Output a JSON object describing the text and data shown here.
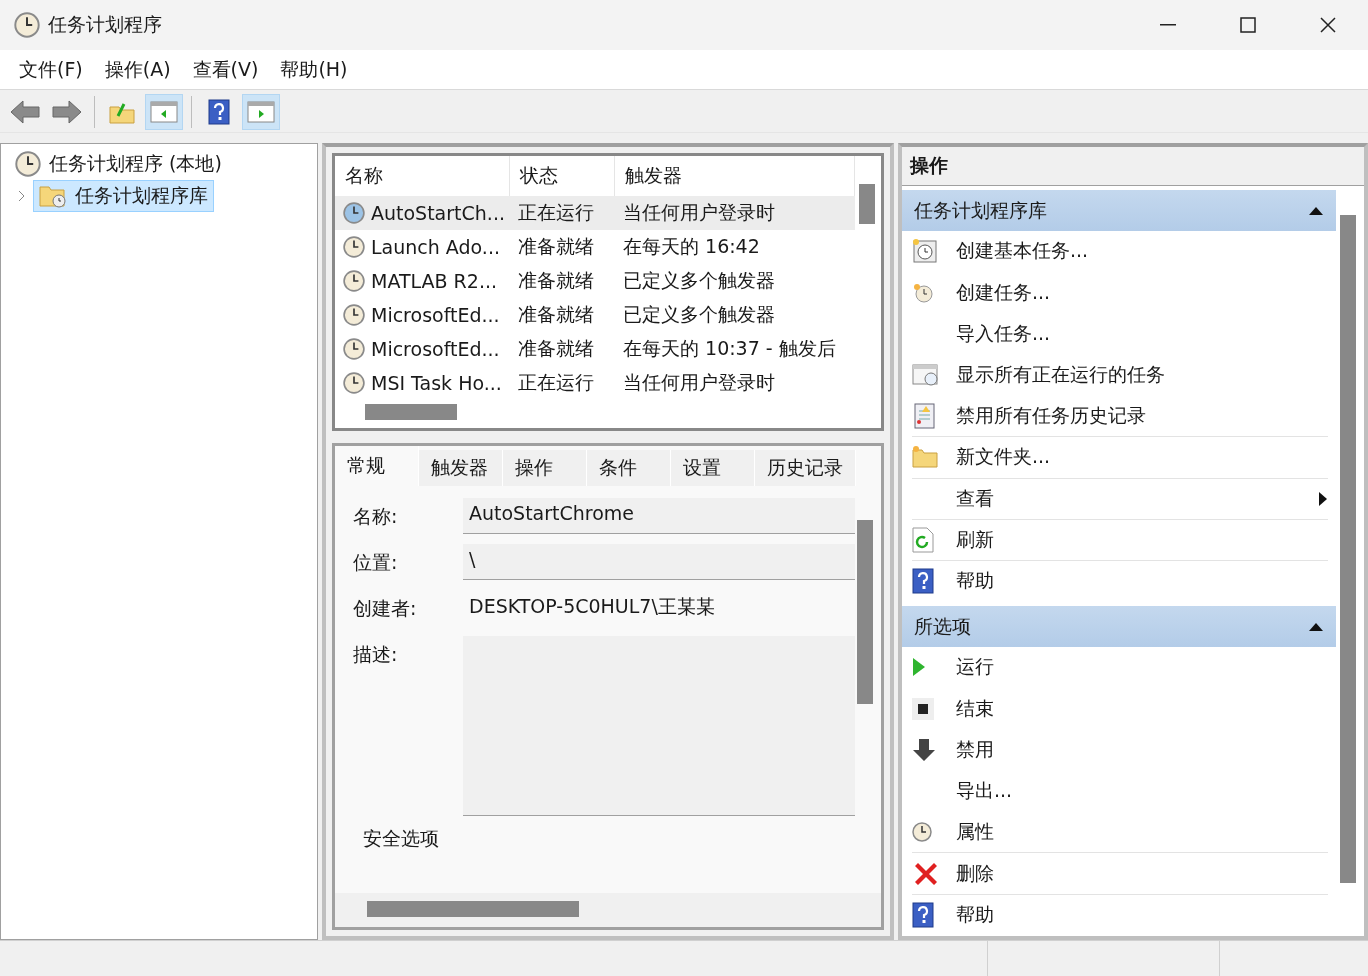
{
  "window": {
    "title": "任务计划程序"
  },
  "menu": [
    "文件(F)",
    "操作(A)",
    "查看(V)",
    "帮助(H)"
  ],
  "toolbar": [
    {
      "kind": "back",
      "selected": false
    },
    {
      "kind": "forward",
      "selected": false
    },
    {
      "kind": "up",
      "selected": false
    },
    {
      "kind": "tree",
      "selected": true
    },
    {
      "kind": "help",
      "selected": false
    },
    {
      "kind": "actions",
      "selected": true
    }
  ],
  "tree": {
    "label": "任务计划程序 (本地)",
    "children": [
      {
        "label": "任务计划程序库",
        "selected": true,
        "expanded": false
      }
    ]
  },
  "task_list": {
    "columns": [
      "名称",
      "状态",
      "触发器"
    ],
    "rows": [
      {
        "name": "AutoStartCh...",
        "status": "正在运行",
        "trigger": "当任何用户登录时",
        "selected": true
      },
      {
        "name": "Launch Ado...",
        "status": "准备就绪",
        "trigger": "在每天的 16:42",
        "selected": false
      },
      {
        "name": "MATLAB R2...",
        "status": "准备就绪",
        "trigger": "已定义多个触发器",
        "selected": false
      },
      {
        "name": "MicrosoftEd...",
        "status": "准备就绪",
        "trigger": "已定义多个触发器",
        "selected": false
      },
      {
        "name": "MicrosoftEd...",
        "status": "准备就绪",
        "trigger": "在每天的 10:37 - 触发后",
        "selected": false
      },
      {
        "name": "MSI Task Ho...",
        "status": "正在运行",
        "trigger": "当任何用户登录时",
        "selected": false
      }
    ]
  },
  "details": {
    "tabs": [
      {
        "label": "常规",
        "selected": true
      },
      {
        "label": "触发器",
        "selected": false
      },
      {
        "label": "操作",
        "selected": false
      },
      {
        "label": "条件",
        "selected": false
      },
      {
        "label": "设置",
        "selected": false
      },
      {
        "label": "历史记录",
        "selected": false
      }
    ],
    "name_label": "名称:",
    "name_value": "AutoStartChrome",
    "location_label": "位置:",
    "location_value": "\\",
    "author_label": "创建者:",
    "author_value": "DESKTOP-5C0HUL7\\王某某",
    "description_label": "描述:",
    "security_label": "安全选项"
  },
  "actions": {
    "title": "操作",
    "sections": [
      {
        "title": "任务计划程序库",
        "expanded": true,
        "items": [
          {
            "label": "创建基本任务...",
            "kind": "basic-task",
            "divider": false,
            "submenu": false
          },
          {
            "label": "创建任务...",
            "kind": "task",
            "divider": false,
            "submenu": false
          },
          {
            "label": "导入任务...",
            "kind": "none",
            "divider": false,
            "submenu": false
          },
          {
            "label": "显示所有正在运行的任务",
            "kind": "running",
            "divider": false,
            "submenu": false
          },
          {
            "label": "禁用所有任务历史记录",
            "kind": "log",
            "divider": true,
            "submenu": false
          },
          {
            "label": "新文件夹...",
            "kind": "folder",
            "divider": true,
            "submenu": false
          },
          {
            "label": "查看",
            "kind": "none",
            "divider": true,
            "submenu": true
          },
          {
            "label": "刷新",
            "kind": "refresh",
            "divider": true,
            "submenu": false
          },
          {
            "label": "帮助",
            "kind": "help",
            "divider": false,
            "submenu": false
          }
        ]
      },
      {
        "title": "所选项",
        "expanded": true,
        "items": [
          {
            "label": "运行",
            "kind": "run",
            "divider": false,
            "submenu": false
          },
          {
            "label": "结束",
            "kind": "stop",
            "divider": false,
            "submenu": false
          },
          {
            "label": "禁用",
            "kind": "disable",
            "divider": false,
            "submenu": false
          },
          {
            "label": "导出...",
            "kind": "none",
            "divider": false,
            "submenu": false
          },
          {
            "label": "属性",
            "kind": "properties",
            "divider": true,
            "submenu": false
          },
          {
            "label": "删除",
            "kind": "delete",
            "divider": true,
            "submenu": false
          },
          {
            "label": "帮助",
            "kind": "help",
            "divider": false,
            "submenu": false
          }
        ]
      }
    ]
  }
}
